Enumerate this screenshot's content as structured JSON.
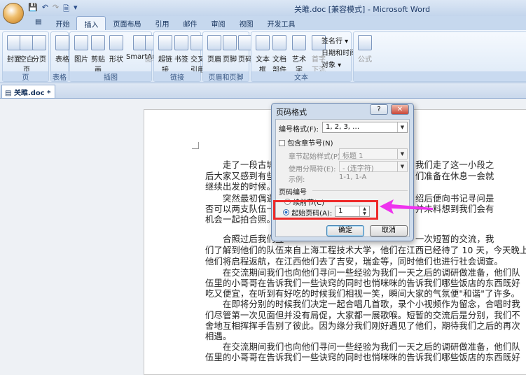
{
  "window": {
    "title": "关雎.doc [兼容模式] - Microsoft Word"
  },
  "tabs": [
    "开始",
    "插入",
    "页面布局",
    "引用",
    "邮件",
    "审阅",
    "视图",
    "开发工具"
  ],
  "active_tab": "插入",
  "ribbon": {
    "groups": [
      {
        "label": "页",
        "buttons": [
          "封面",
          "空白页",
          "分页"
        ]
      },
      {
        "label": "表格",
        "buttons": [
          "表格"
        ]
      },
      {
        "label": "插图",
        "buttons": [
          "图片",
          "剪贴画",
          "形状",
          "SmartArt",
          "图表"
        ]
      },
      {
        "label": "链接",
        "buttons": [
          "超链接",
          "书签",
          "交叉\n引用"
        ]
      },
      {
        "label": "页眉和页脚",
        "buttons": [
          "页眉",
          "页脚",
          "页码"
        ]
      },
      {
        "label": "文本",
        "buttons": [
          "文本框",
          "文档部件",
          "艺术字",
          "首字下沉"
        ],
        "small": [
          "签名行 ▾",
          "日期和时间",
          "对象 ▾"
        ]
      },
      {
        "label": "",
        "buttons": [
          "公式"
        ]
      }
    ]
  },
  "document_tab": "关雎.doc *",
  "document": {
    "lines": [
      {
        "left": "走了一段古城墙",
        "right": "我们走了这一小段之",
        "indent": true
      },
      {
        "left": "后大家又感到有些疲",
        "right": "们准备在休息一会就"
      },
      {
        "left": "继续出发的时候。"
      },
      {
        "left": "突然最初偶遇的",
        "right": "绍后便向书记寻问是",
        "indent": true
      },
      {
        "left": "否可以两支队伍一起",
        "right": "并未料想到我们会有"
      },
      {
        "left": "机会一起拍合照。"
      },
      {
        "left": "合照过后我们互",
        "right": "一次短暂的交流，我",
        "indent": true,
        "gap": true
      },
      {
        "left": "们了解到他们的队伍来自上海工程技术大学，他们在江西已经待了 10 天，今天晚上"
      },
      {
        "left": "他们将启程返航，在江西他们去了吉安，瑞金等，同时他们也进行社会调查。"
      },
      {
        "left": "在交流期间我们也向他们寻问一些经验为我们一天之后的调研做准备，他们队",
        "indent": true
      },
      {
        "left": "伍里的小哥哥在告诉我们一些诀窍的同时也悄咪咪的告诉我们哪些饭店的东西既好"
      },
      {
        "left": "吃又便宜，在听到有好吃的时候我们相视一笑，瞬间大家的气氛便\"和谐\"了许多。"
      },
      {
        "left": "在即将分别的时候我们决定一起合唱几首歌，录个小视频作为留念，合唱时我",
        "indent": true
      },
      {
        "left": "们尽管第一次见面但并没有局促，大家都一展歌喉。短暂的交流后是分别，我们不"
      },
      {
        "left": "舍地互相挥挥手告别了彼此。因为缘分我们刚好遇见了他们，期待我们之后的再次"
      },
      {
        "left": "相遇。"
      },
      {
        "left": "在交流期间我们也向他们寻问一些经验为我们一天之后的调研做准备，他们队",
        "indent": true
      },
      {
        "left": "伍里的小哥哥在告诉我们一些诀窍的同时也悄咪咪的告诉我们哪些饭店的东西既好"
      }
    ]
  },
  "dialog": {
    "title": "页码格式",
    "help": "?",
    "close": "✕",
    "number_format_label": "编号格式(F):",
    "number_format_value": "1, 2, 3, …",
    "include_chapter_label": "包含章节号(N)",
    "chapter_style_label": "章节起始样式(P)",
    "chapter_style_value": "标题 1",
    "separator_label": "使用分隔符(E):",
    "separator_value": "-  (连字符)",
    "example_label": "示例:",
    "example_value": "1-1, 1-A",
    "page_numbering_label": "页码编号",
    "continue_label": "续前节(C)",
    "start_at_label": "起始页码(A):",
    "start_at_value": "1",
    "ok": "确定",
    "cancel": "取消"
  },
  "colors": {
    "highlight": "#ee2a2a",
    "arrow": "#ee33ee"
  }
}
